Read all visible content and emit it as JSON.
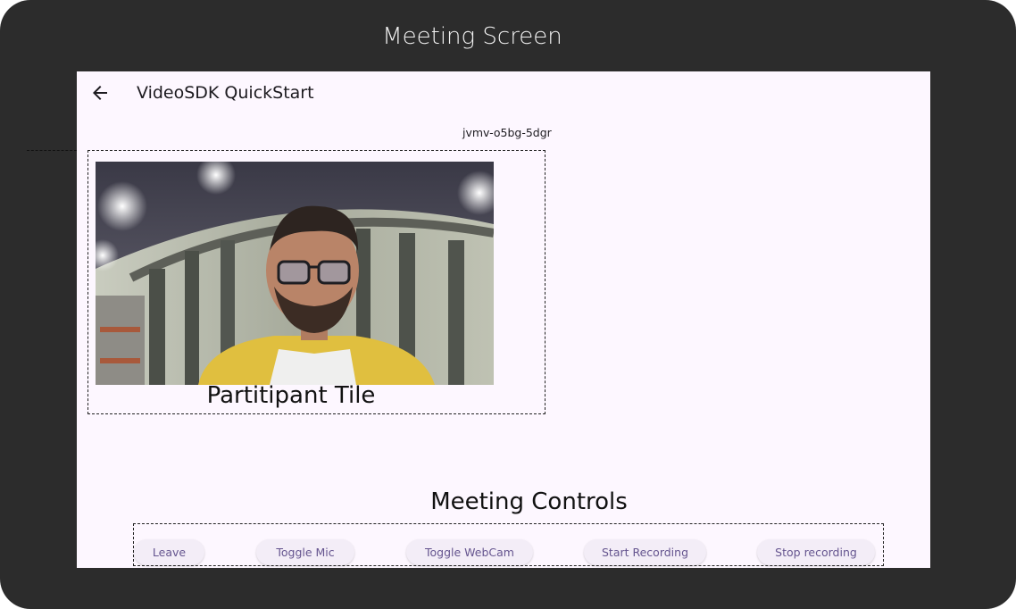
{
  "frame": {
    "title": "Meeting Screen"
  },
  "appbar": {
    "back_icon": "arrow-left-icon",
    "title": "VideoSDK QuickStart"
  },
  "meeting": {
    "id": "jvmv-o5bg-5dgr"
  },
  "tile": {
    "caption": "Partitipant Tile"
  },
  "controls": {
    "caption": "Meeting Controls",
    "buttons": [
      {
        "label": "Leave"
      },
      {
        "label": "Toggle Mic"
      },
      {
        "label": "Toggle WebCam"
      },
      {
        "label": "Start Recording"
      },
      {
        "label": "Stop recording"
      }
    ]
  },
  "colors": {
    "frame_bg": "#2c2c2c",
    "screen_bg": "#fdf7ff",
    "button_bg": "#f3edf7",
    "button_text": "#65558f"
  }
}
